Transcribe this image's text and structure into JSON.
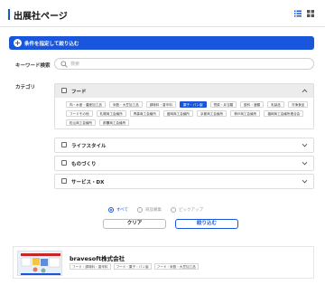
{
  "header": {
    "title": "出展社ページ",
    "view_icons": [
      "list-view-icon",
      "grid-view-icon"
    ]
  },
  "search_panel": {
    "condition_bar_label": "条件を指定して絞り込む",
    "keyword": {
      "label": "キーワード検索",
      "placeholder": "検索",
      "value": ""
    },
    "category_label": "カテゴリ",
    "categories": [
      {
        "name": "フード",
        "open": true,
        "chips": [
          {
            "label": "肉・水産・農産加工品",
            "active": false
          },
          {
            "label": "米穀・大豆加工品",
            "active": false
          },
          {
            "label": "調味料・香辛料",
            "active": false
          },
          {
            "label": "菓子・パン製",
            "active": true
          },
          {
            "label": "惣菜・弁当類",
            "active": false
          },
          {
            "label": "飲料・酒類",
            "active": false
          },
          {
            "label": "乳製品",
            "active": false
          },
          {
            "label": "冷凍食品",
            "active": false
          },
          {
            "label": "フードその他",
            "active": false
          },
          {
            "label": "札幌商工会議所",
            "active": false
          },
          {
            "label": "青森商工会議所",
            "active": false
          },
          {
            "label": "盛岡商工会議所",
            "active": false
          },
          {
            "label": "京都商工会議所",
            "active": false
          },
          {
            "label": "神戸商工会議所",
            "active": false
          },
          {
            "label": "福岡商工会議所連合会",
            "active": false
          },
          {
            "label": "松山商工会議所",
            "active": false
          },
          {
            "label": "那覇商工会議所",
            "active": false
          }
        ]
      },
      {
        "name": "ライフスタイル",
        "open": false,
        "chips": []
      },
      {
        "name": "ものづくり",
        "open": false,
        "chips": []
      },
      {
        "name": "サービス・DX",
        "open": false,
        "chips": []
      }
    ],
    "display_filter": {
      "options": [
        {
          "label": "すべて",
          "selected": true
        },
        {
          "label": "商談募集",
          "selected": false
        },
        {
          "label": "ピックアップ",
          "selected": false
        }
      ]
    },
    "buttons": {
      "clear": "クリア",
      "filter": "絞り込む"
    }
  },
  "results": [
    {
      "company": "bravesoft株式会社",
      "tags": [
        "フード・調味料・香辛料",
        "フード・菓子・パン製",
        "フード・米穀・大豆加工品"
      ]
    }
  ],
  "colors": {
    "accent": "#1a56db",
    "chip_active_bg": "#1a56db",
    "panel_head_bg": "#ececec"
  }
}
